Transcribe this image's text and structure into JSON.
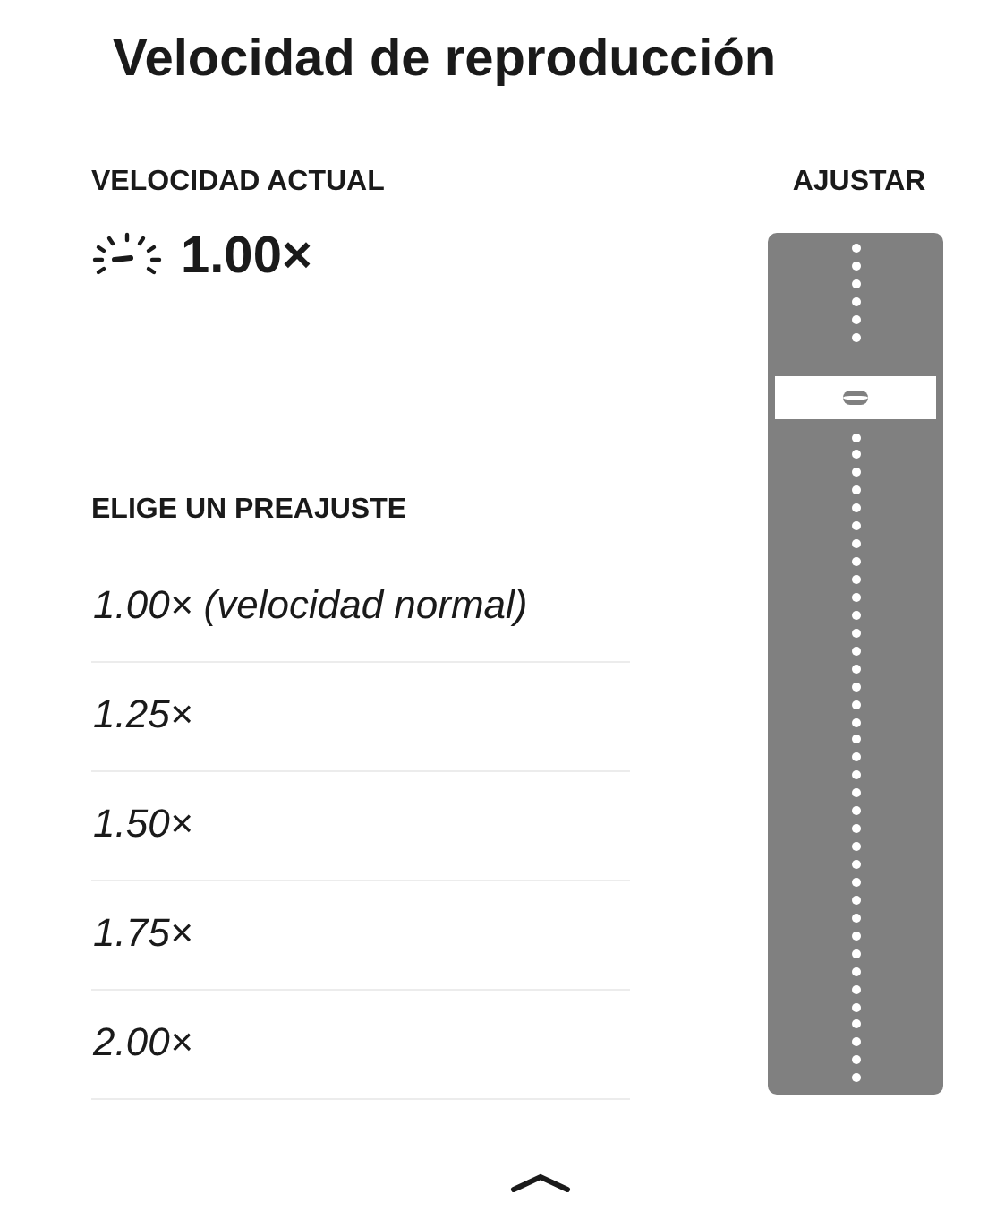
{
  "title": "Velocidad de reproducción",
  "current": {
    "label": "VELOCIDAD ACTUAL",
    "value": "1.00×"
  },
  "adjust": {
    "label": "AJUSTAR"
  },
  "presets_label": "ELIGE UN PREAJUSTE",
  "presets": [
    {
      "label": "1.00× (velocidad normal)",
      "selected": false
    },
    {
      "label": "1.25×",
      "selected": false
    },
    {
      "label": "1.50×",
      "selected": false
    },
    {
      "label": "1.75×",
      "selected": false
    },
    {
      "label": "2.00×",
      "selected": false
    }
  ]
}
